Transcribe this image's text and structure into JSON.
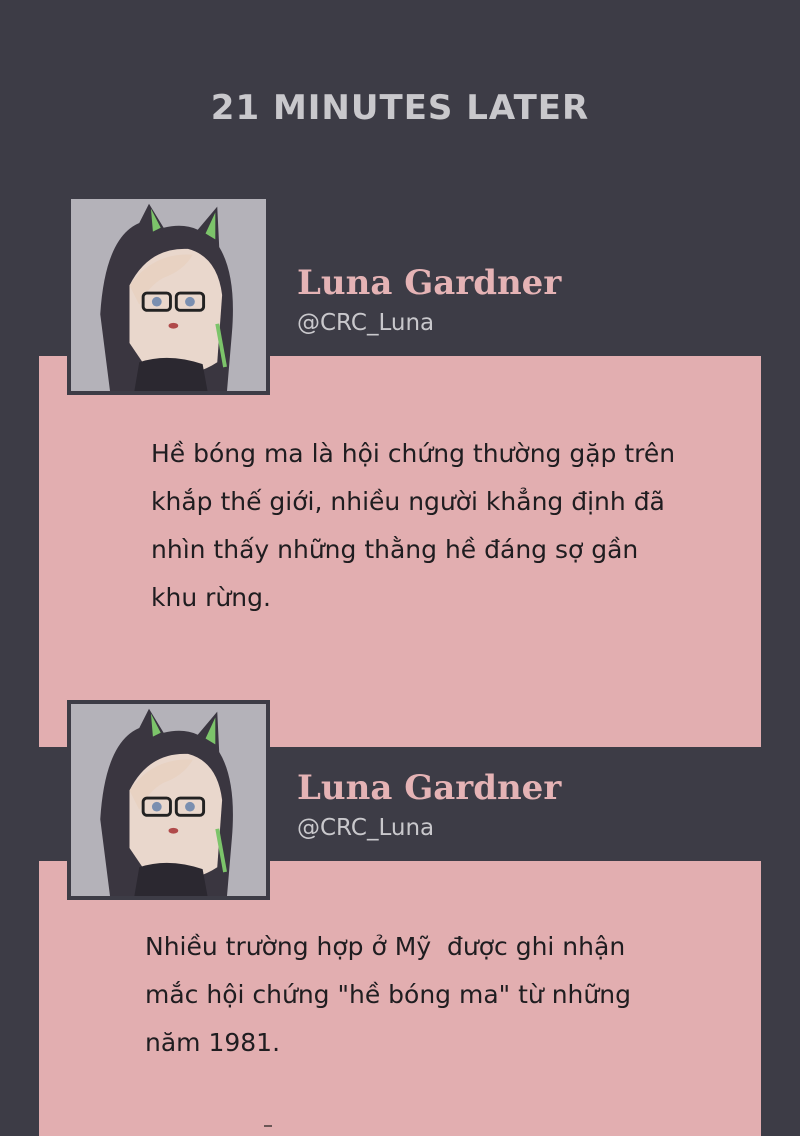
{
  "header": {
    "time_label": "21 MINUTES LATER"
  },
  "posts": [
    {
      "avatar_icon": "avatar-icon",
      "username": "Luna Gardner",
      "handle": "@CRC_Luna",
      "lines": [
        "Hề bóng ma là hội chứng thường gặp trên",
        "khắp thế giới, nhiều người khẳng định đã",
        "nhìn thấy những thằng hề đáng sợ gần",
        "khu rừng."
      ]
    },
    {
      "avatar_icon": "avatar-icon",
      "username": "Luna Gardner",
      "handle": "@CRC_Luna",
      "lines": [
        "Nhiều trường hợp ở Mỹ  được ghi nhận",
        "mắc hội chứng \"hề bóng ma\" từ những",
        "năm 1981."
      ]
    }
  ],
  "colors": {
    "background": "#3d3c46",
    "card": "#e2aeb0",
    "username": "#e5b3b5",
    "handle": "#c9c8cc",
    "text": "#1f1d20"
  }
}
